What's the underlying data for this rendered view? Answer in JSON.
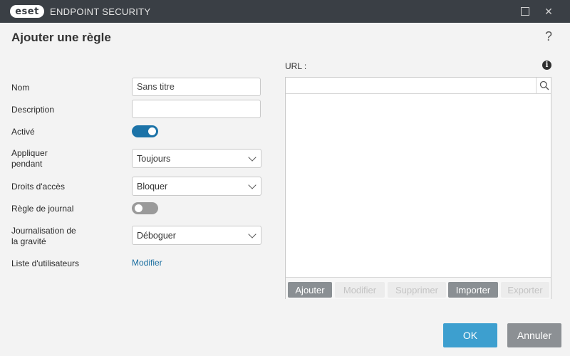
{
  "window": {
    "logo_text": "eset",
    "title": "ENDPOINT SECURITY",
    "close_glyph": "✕"
  },
  "header": {
    "title": "Ajouter une règle",
    "help_glyph": "?"
  },
  "form": {
    "name_label": "Nom",
    "name_value": "Sans titre",
    "description_label": "Description",
    "description_value": "",
    "active_label": "Activé",
    "active_on": true,
    "apply_label_line1": "Appliquer",
    "apply_label_line2": "pendant",
    "apply_value": "Toujours",
    "access_label": "Droits d'accès",
    "access_value": "Bloquer",
    "log_rule_label": "Règle de journal",
    "log_rule_on": false,
    "severity_label_line1": "Journalisation de",
    "severity_label_line2": "la gravité",
    "severity_value": "Déboguer",
    "users_label": "Liste d'utilisateurs",
    "users_link": "Modifier"
  },
  "url": {
    "label": "URL :",
    "info_glyph": "i",
    "search_value": "",
    "buttons": {
      "add": "Ajouter",
      "edit": "Modifier",
      "delete": "Supprimer",
      "import": "Importer",
      "export": "Exporter"
    }
  },
  "footer": {
    "ok": "OK",
    "cancel": "Annuler"
  },
  "colors": {
    "accent": "#1c73a8",
    "ok_button": "#3d9fcf",
    "titlebar": "#3a3f45"
  },
  "icons": {
    "search": "search-icon",
    "info": "info-icon",
    "help": "help-icon",
    "maximize": "maximize-icon",
    "close": "close-icon",
    "dropdown": "chevron-down-icon"
  }
}
